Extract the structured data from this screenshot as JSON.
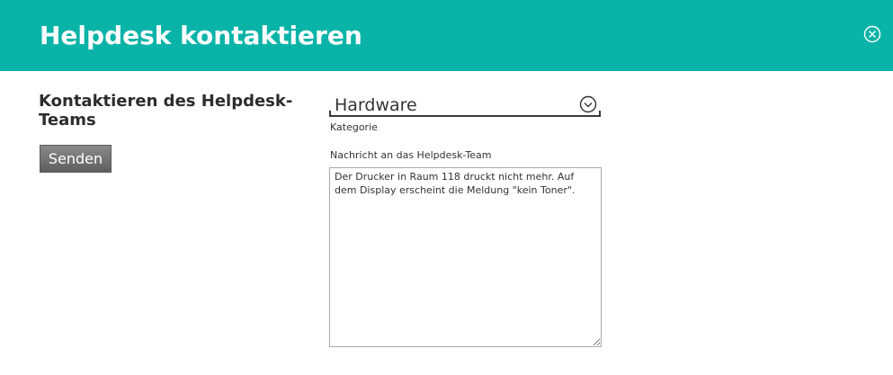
{
  "dialog": {
    "title": "Helpdesk kontaktieren",
    "close_icon": "close-circle-icon",
    "accent_color": "#0ab3a7"
  },
  "left": {
    "heading": "Kontaktieren des Helpdesk-Teams",
    "send_label": "Senden"
  },
  "form": {
    "category": {
      "value": "Hardware",
      "caption": "Kategorie",
      "icon": "chevron-down-circle-icon"
    },
    "message": {
      "label": "Nachricht an das Helpdesk-Team",
      "value": "Der Drucker in Raum 118 druckt nicht mehr. Auf dem Display erscheint die Meldung \"kein Toner\"."
    }
  }
}
